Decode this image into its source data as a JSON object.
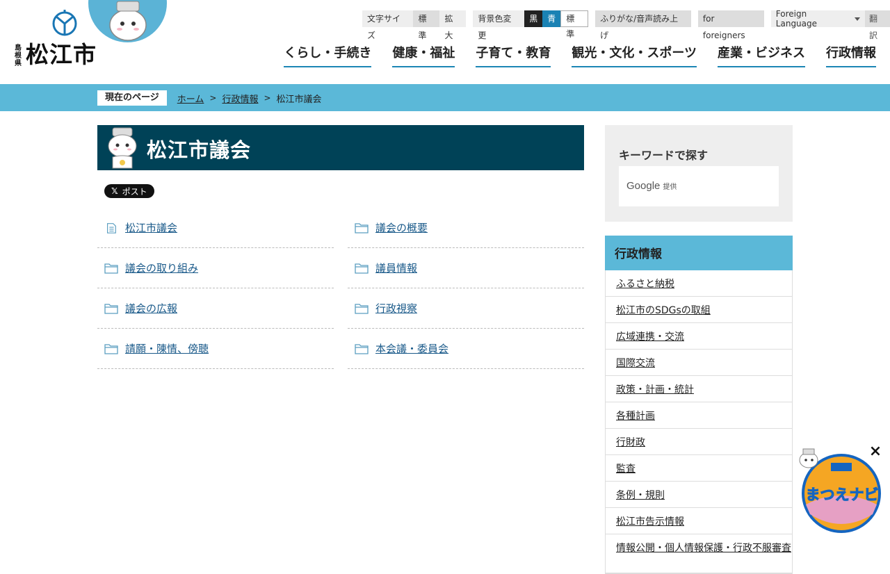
{
  "header": {
    "logo_pref": "島根県",
    "logo_city": "松江市",
    "util": {
      "font_size_label": "文字サイズ",
      "font_standard": "標準",
      "font_large": "拡大",
      "bg_label": "背景色変更",
      "bg_black": "黒",
      "bg_blue": "青",
      "bg_standard": "標準",
      "furigana": "ふりがな/音声読み上げ",
      "foreigners": "for foreigners",
      "foreign_language": "Foreign Language",
      "translate": "翻訳"
    },
    "nav": [
      "くらし・手続き",
      "健康・福祉",
      "子育て・教育",
      "観光・文化・スポーツ",
      "産業・ビジネス",
      "行政情報"
    ]
  },
  "breadcrumb": {
    "current_label": "現在のページ",
    "home": "ホーム",
    "parent": "行政情報",
    "current": "松江市議会"
  },
  "main": {
    "title": "松江市議会",
    "post_button": "ポスト",
    "links": [
      {
        "label": "松江市議会",
        "icon": "document-icon"
      },
      {
        "label": "議会の概要",
        "icon": "folder-icon"
      },
      {
        "label": "議会の取り組み",
        "icon": "folder-icon"
      },
      {
        "label": "議員情報",
        "icon": "folder-icon"
      },
      {
        "label": "議会の広報",
        "icon": "folder-icon"
      },
      {
        "label": "行政視察",
        "icon": "folder-icon"
      },
      {
        "label": "請願・陳情、傍聴",
        "icon": "folder-icon"
      },
      {
        "label": "本会議・委員会",
        "icon": "folder-icon"
      }
    ]
  },
  "sidebar": {
    "keyword_title": "キーワードで探す",
    "google_label": "Google",
    "google_provided": "提供",
    "admin_title": "行政情報",
    "admin_items": [
      "ふるさと納税",
      "松江市のSDGsの取組",
      "広域連携・交流",
      "国際交流",
      "政策・計画・統計",
      "各種計画",
      "行財政",
      "監査",
      "条例・規則",
      "松江市告示情報",
      "情報公開・個人情報保護・行政不服審査"
    ]
  },
  "navi": {
    "label": "まつえナビ",
    "close": "×"
  },
  "colors": {
    "accent_blue": "#5bb8d8",
    "title_bg": "#004257",
    "nav_underline": "#1b86b5"
  }
}
